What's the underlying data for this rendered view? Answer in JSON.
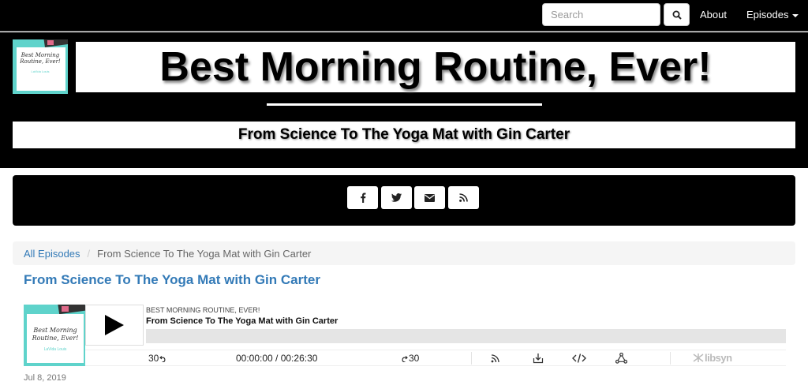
{
  "nav": {
    "search_placeholder": "Search",
    "about_label": "About",
    "episodes_label": "Episodes"
  },
  "hero": {
    "logo_title": "Best Morning Routine, Ever!",
    "logo_subtitle": "LaVida Louis",
    "title": "Best Morning Routine, Ever!",
    "subtitle": "From Science To The Yoga Mat with Gin Carter"
  },
  "social": {
    "icons": [
      "facebook-icon",
      "twitter-icon",
      "email-icon",
      "rss-icon"
    ]
  },
  "breadcrumb": {
    "home_label": "All Episodes",
    "current_label": "From Science To The Yoga Mat with Gin Carter"
  },
  "episode": {
    "title": "From Science To The Yoga Mat with Gin Carter",
    "date": "Jul 8, 2019"
  },
  "player": {
    "show_name": "BEST MORNING ROUTINE, EVER!",
    "episode_title": "From Science To The Yoga Mat with Gin Carter",
    "back_label": "30",
    "time_label": "00:00:00 / 00:26:30",
    "forward_label": "30",
    "brand_label": "libsyn",
    "progress": 0
  },
  "colors": {
    "link": "#337ab7",
    "accent_teal": "#5fd3cb",
    "hero_bg": "#000000"
  }
}
